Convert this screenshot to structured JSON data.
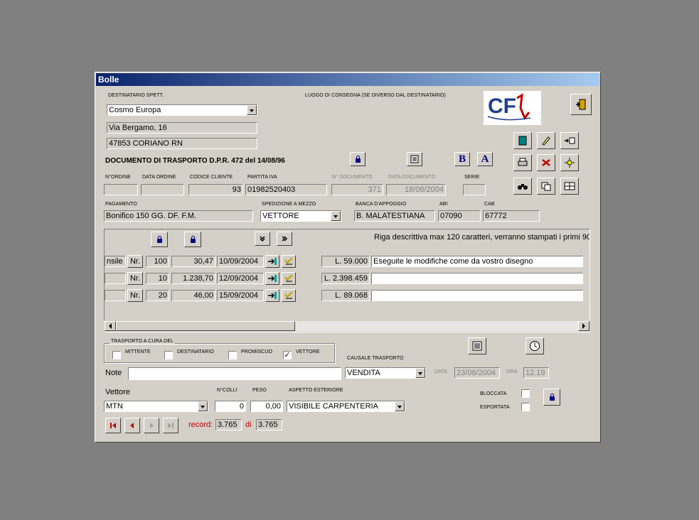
{
  "window": {
    "title": "Bolle"
  },
  "header": {
    "destinatario_label": "DESTINATARIO SPETT.",
    "destinatario_value": "Cosmo Europa",
    "address_line1": "Via Bergamo, 16",
    "address_line2": "47853 CORIANO RN",
    "luogo_label": "LUOGO DI CONSEGNA (SE DIVERSO DAL DESTINATARIO)",
    "doc_title": "DOCUMENTO DI TRASPORTO D.P.R. 472 del 14/08/96"
  },
  "logo": {
    "text": "CF"
  },
  "order": {
    "n_ordine_label": "N°ORDINE",
    "n_ordine_value": "",
    "data_ordine_label": "DATA ORDINE",
    "data_ordine_value": "",
    "codice_cliente_label": "CODICE CLIENTE",
    "codice_cliente_value": "93",
    "partita_iva_label": "PARTITA IVA",
    "partita_iva_value": "01982520403",
    "n_documento_label": "N° DOCUMENTO",
    "n_documento_value": "371",
    "data_documento_label": "DATA DOCUMENTO",
    "data_documento_value": "18/08/2004",
    "serie_label": "SERIE",
    "serie_value": ""
  },
  "payment": {
    "pagamento_label": "PAGAMENTO",
    "pagamento_value": "Bonifico 150 GG. DF. F.M.",
    "spedizione_label": "SPEDIZIONE A MEZZO",
    "spedizione_value": "VETTORE",
    "banca_label": "BANCA D'APPOGGIO",
    "banca_value": "B. MALATESTIANA",
    "abi_label": "ABI",
    "abi_value": "07090",
    "cab_label": "CAB",
    "cab_value": "67772"
  },
  "rows_header": {
    "note": "Riga descrittiva max 120 caratteri, verranno stampati i primi 90"
  },
  "rows": [
    {
      "code": "nsile c",
      "unit": "Nr.",
      "qty": "100",
      "price": "30,47",
      "date": "10/09/2004",
      "total": "L. 59.000",
      "desc": "Eseguite le modifiche come da vostro disegno"
    },
    {
      "code": "",
      "unit": "Nr.",
      "qty": "10",
      "price": "1.238,70",
      "date": "12/09/2004",
      "total": "L. 2.398.459",
      "desc": ""
    },
    {
      "code": "",
      "unit": "Nr.",
      "qty": "20",
      "price": "46,00",
      "date": "15/09/2004",
      "total": "L. 89.068",
      "desc": ""
    }
  ],
  "trasporto": {
    "group_label": "TRASPORTO A CURA DEL",
    "mittente": "MITTENTE",
    "destinatario": "DESTINATARIO",
    "promiscuo": "PROMISCUO",
    "vettore": "VETTORE",
    "vettore_checked": "✓"
  },
  "causale": {
    "label": "CAUSALE TRASPORTO",
    "value": "VENDITA"
  },
  "note": {
    "label": "Note",
    "value": ""
  },
  "datetime": {
    "data_label": "DATA",
    "data_value": "23/08/2004",
    "ora_label": "ORA",
    "ora_value": "12.19"
  },
  "carrier": {
    "vettore_label": "Vettore",
    "vettore_value": "MTN",
    "colli_label": "N°COLLI",
    "colli_value": "0",
    "peso_label": "PESO",
    "peso_value": "0,00",
    "aspetto_label": "ASPETTO ESTERIORE",
    "aspetto_value": "VISIBILE CARPENTERIA"
  },
  "flags": {
    "bloccata_label": "BLOCCATA",
    "esportata_label": "ESPORTATA"
  },
  "record": {
    "label": "record:",
    "current": "3.765",
    "of_label": "di",
    "total": "3.765"
  },
  "buttons": {
    "bold": "B",
    "font": "A"
  }
}
